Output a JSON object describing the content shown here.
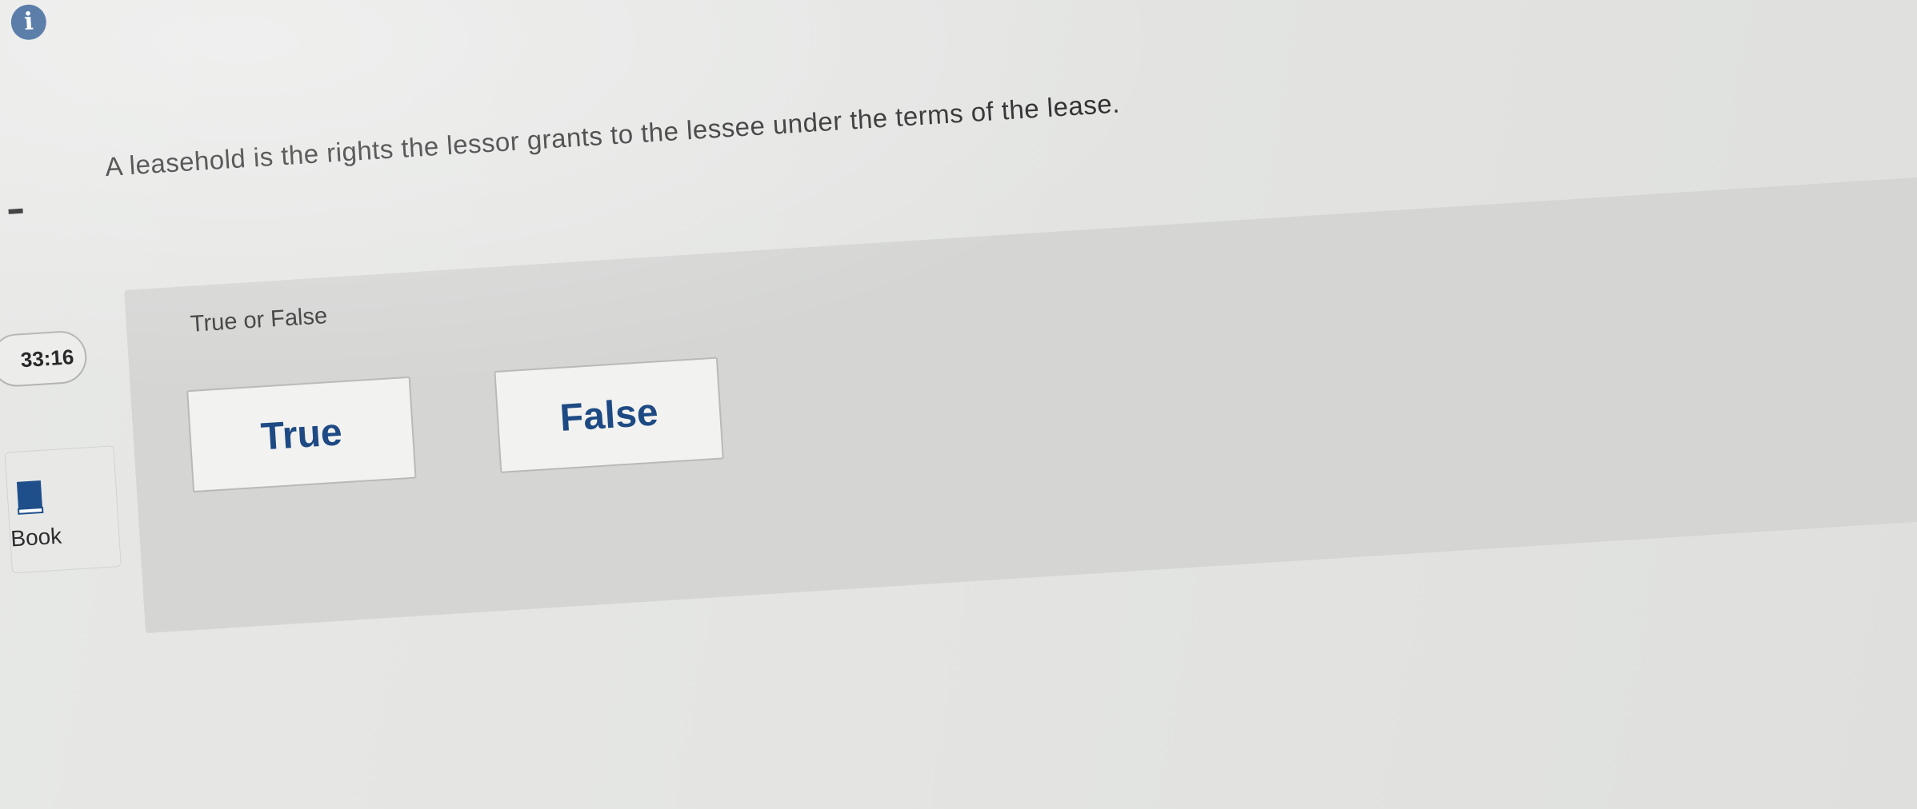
{
  "question": {
    "text": "A leasehold is the rights the lessor grants to the lessee under the terms of the lease.",
    "type_label": "True or False"
  },
  "answers": [
    {
      "label": "True"
    },
    {
      "label": "False"
    }
  ],
  "sidebar": {
    "timer": "33:16",
    "book_label": "Book"
  },
  "icons": {
    "info": "info-icon",
    "info_glyph": "i",
    "book": "book-icon"
  },
  "colors": {
    "accent": "#1e4a84",
    "panel": "#d5d6d4",
    "background": "#e7e8e6"
  }
}
